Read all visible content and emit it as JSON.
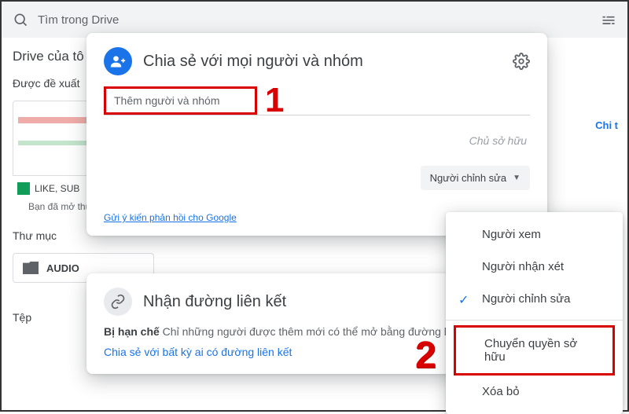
{
  "search": {
    "placeholder": "Tìm trong Drive"
  },
  "bg": {
    "mydrive": "Drive của tô",
    "suggested": "Được đề xuất",
    "thumb_label": "LIKE, SUB",
    "thumb_sub": "Bạn đã mở thườ",
    "folders_label": "Thư mục",
    "folder1": "AUDIO",
    "files_label": "Tệp",
    "right_tab": "Chi t"
  },
  "share": {
    "title": "Chia sẻ với mọi người và nhóm",
    "input_placeholder": "Thêm người và nhóm",
    "owner": "Chủ sở hữu",
    "editor_chip": "Người chỉnh sửa",
    "feedback": "Gửi ý kiến phản hồi cho Google"
  },
  "link": {
    "title": "Nhận đường liên kết",
    "restricted_bold": "Bị hạn chế",
    "restricted_rest": " Chỉ những người được thêm mới có thể mở bằng đường liên kết này",
    "share_any": "Chia sẻ với bất kỳ ai có đường liên kết"
  },
  "menu": {
    "viewer": "Người xem",
    "commenter": "Người nhận xét",
    "editor": "Người chỉnh sửa",
    "transfer": "Chuyển quyền sở hữu",
    "remove": "Xóa bỏ"
  },
  "annot": {
    "n1": "1",
    "n2": "2"
  }
}
